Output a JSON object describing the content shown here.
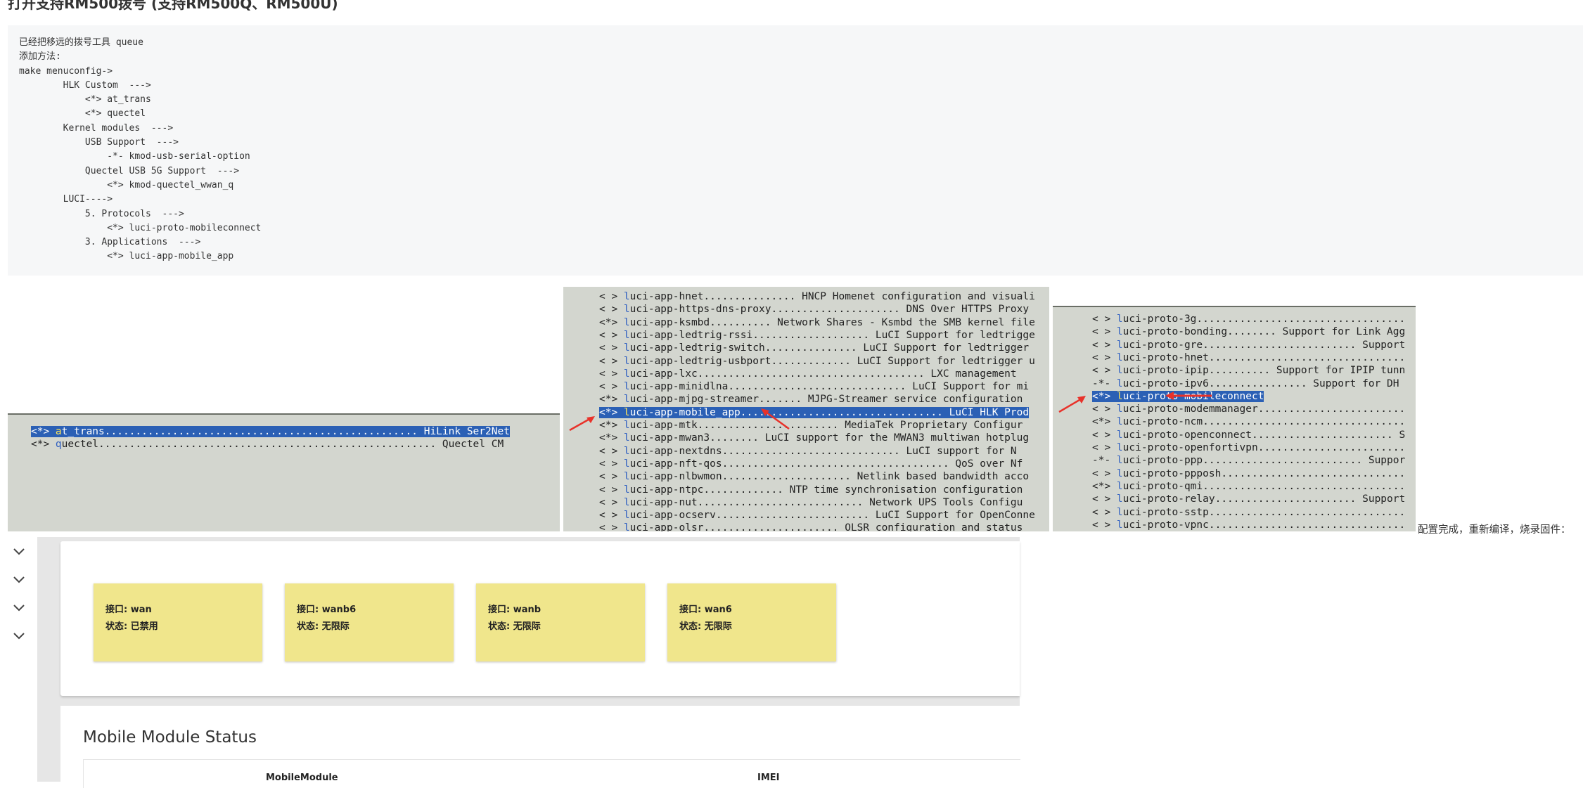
{
  "heading": "打开支持RM500拨号 (支持RM500Q、RM500U)",
  "config_lines": [
    "已经把移远的拨号工具 queue",
    "添加方法:",
    "make menuconfig->",
    "        HLK Custom  --->",
    "            <*> at_trans",
    "            <*> quectel",
    "        Kernel modules  --->",
    "            USB Support  --->",
    "                -*- kmod-usb-serial-option",
    "            Quectel USB 5G Support  --->",
    "                <*> kmod-quectel_wwan_q",
    "        LUCI---->",
    "            5. Protocols  --->",
    "                <*> luci-proto-mobileconnect",
    "            3. Applications  --->",
    "                <*> luci-app-mobile_app"
  ],
  "term1": {
    "rows": [
      {
        "mark": "<*> ",
        "key": "a",
        "rest": "t_trans................................................... HiLink Ser2Net",
        "selected": true
      },
      {
        "mark": "<*> ",
        "key": "q",
        "rest": "uectel....................................................... Quectel CM",
        "selected": false
      }
    ]
  },
  "term2": {
    "rows": [
      {
        "mark": "< > ",
        "key": "l",
        "rest": "uci-app-hnet............... HNCP Homenet configuration and visuali",
        "selected": false
      },
      {
        "mark": "< > ",
        "key": "l",
        "rest": "uci-app-https-dns-proxy..................... DNS Over HTTPS Proxy",
        "selected": false
      },
      {
        "mark": "<*> ",
        "key": "l",
        "rest": "uci-app-ksmbd.......... Network Shares - Ksmbd the SMB kernel file",
        "selected": false
      },
      {
        "mark": "< > ",
        "key": "l",
        "rest": "uci-app-ledtrig-rssi................... LuCI Support for ledtrigge",
        "selected": false
      },
      {
        "mark": "< > ",
        "key": "l",
        "rest": "uci-app-ledtrig-switch............... LuCI Support for ledtrigger",
        "selected": false
      },
      {
        "mark": "< > ",
        "key": "l",
        "rest": "uci-app-ledtrig-usbport............. LuCI Support for ledtrigger u",
        "selected": false
      },
      {
        "mark": "< > ",
        "key": "l",
        "rest": "uci-app-lxc..................................... LXC management",
        "selected": false
      },
      {
        "mark": "< > ",
        "key": "l",
        "rest": "uci-app-minidlna............................. LuCI Support for mi",
        "selected": false
      },
      {
        "mark": "<*> ",
        "key": "l",
        "rest": "uci-app-mjpg-streamer....... MJPG-Streamer service configuration",
        "selected": false
      },
      {
        "mark": "<*> ",
        "key": "l",
        "rest": "uci-app-mobile_app................................. LuCI HLK Prod",
        "selected": true
      },
      {
        "mark": "<*> ",
        "key": "l",
        "rest": "uci-app-mtk....................... MediaTek Proprietary Configur",
        "selected": false
      },
      {
        "mark": "<*> ",
        "key": "l",
        "rest": "uci-app-mwan3........ LuCI support for the MWAN3 multiwan hotplug",
        "selected": false
      },
      {
        "mark": "< > ",
        "key": "l",
        "rest": "uci-app-nextdns............................. LuCI support for N",
        "selected": false
      },
      {
        "mark": "< > ",
        "key": "l",
        "rest": "uci-app-nft-qos..................................... QoS over Nf",
        "selected": false
      },
      {
        "mark": "< > ",
        "key": "l",
        "rest": "uci-app-nlbwmon..................... Netlink based bandwidth acco",
        "selected": false
      },
      {
        "mark": "< > ",
        "key": "l",
        "rest": "uci-app-ntpc............. NTP time synchronisation configuration",
        "selected": false
      },
      {
        "mark": "< > ",
        "key": "l",
        "rest": "uci-app-nut........................... Network UPS Tools Configu",
        "selected": false
      },
      {
        "mark": "< > ",
        "key": "l",
        "rest": "uci-app-ocserv......................... LuCI Support for OpenConne",
        "selected": false
      },
      {
        "mark": "< > ",
        "key": "l",
        "rest": "uci-app-olsr...................... OLSR configuration and status",
        "selected": false
      }
    ]
  },
  "term3": {
    "rows": [
      {
        "mark": "< > ",
        "key": "l",
        "rest": "uci-proto-3g..................................",
        "selected": false
      },
      {
        "mark": "< > ",
        "key": "l",
        "rest": "uci-proto-bonding........ Support for Link Agg",
        "selected": false
      },
      {
        "mark": "< > ",
        "key": "l",
        "rest": "uci-proto-gre......................... Support",
        "selected": false
      },
      {
        "mark": "< > ",
        "key": "l",
        "rest": "uci-proto-hnet................................",
        "selected": false
      },
      {
        "mark": "< > ",
        "key": "l",
        "rest": "uci-proto-ipip.......... Support for IPIP tunn",
        "selected": false
      },
      {
        "mark": "-*- ",
        "key": "l",
        "rest": "uci-proto-ipv6................ Support for DH",
        "selected": false
      },
      {
        "mark": "<*> ",
        "key": "l",
        "rest": "uci-proto-mobileconnect",
        "selected": true
      },
      {
        "mark": "< > ",
        "key": "l",
        "rest": "uci-proto-modemmanager........................",
        "selected": false
      },
      {
        "mark": "<*> ",
        "key": "l",
        "rest": "uci-proto-ncm.................................",
        "selected": false
      },
      {
        "mark": "< > ",
        "key": "l",
        "rest": "uci-proto-openconnect....................... S",
        "selected": false
      },
      {
        "mark": "< > ",
        "key": "l",
        "rest": "uci-proto-openfortivpn........................",
        "selected": false
      },
      {
        "mark": "-*- ",
        "key": "l",
        "rest": "uci-proto-ppp.......................... Suppor",
        "selected": false
      },
      {
        "mark": "< > ",
        "key": "l",
        "rest": "uci-proto-ppposh..............................",
        "selected": false
      },
      {
        "mark": "<*> ",
        "key": "l",
        "rest": "uci-proto-qmi.................................",
        "selected": false
      },
      {
        "mark": "< > ",
        "key": "l",
        "rest": "uci-proto-relay....................... Support",
        "selected": false
      },
      {
        "mark": "< > ",
        "key": "l",
        "rest": "uci-proto-sstp................................",
        "selected": false
      },
      {
        "mark": "< > ",
        "key": "l",
        "rest": "uci-proto-vpnc................................",
        "selected": false
      }
    ]
  },
  "note": "配置完成，重新编译，烧录固件：",
  "interfaces": [
    {
      "name": "接口: wan",
      "status": "状态: 已禁用"
    },
    {
      "name": "接口: wanb6",
      "status": "状态: 无限际"
    },
    {
      "name": "接口: wanb",
      "status": "状态: 无限际"
    },
    {
      "name": "接口: wan6",
      "status": "状态: 无限际"
    }
  ],
  "mobile_section": {
    "title": "Mobile Module Status",
    "columns": [
      "MobileModule",
      "IMEI"
    ]
  },
  "colors": {
    "terminal_bg": "#d3d6cf",
    "selection": "#2b60b5",
    "interface_card": "#f0e68c",
    "arrow": "#e8322a"
  },
  "icons": [
    "chevron-down-icon",
    "red-arrow-icon"
  ]
}
